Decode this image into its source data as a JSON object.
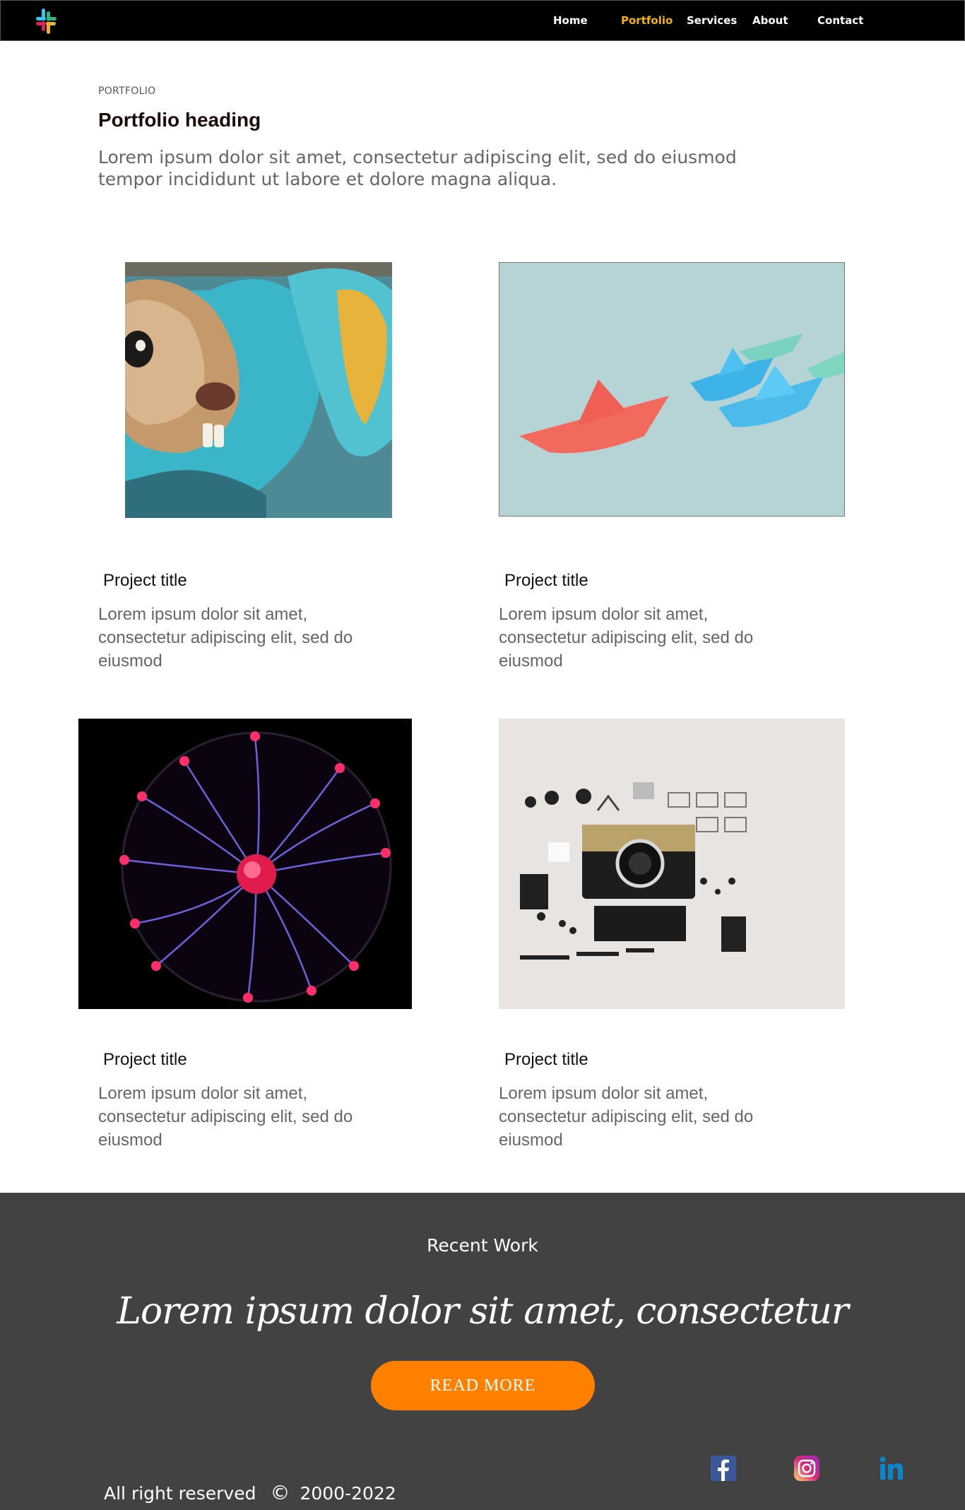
{
  "nav": {
    "logo_icon": "slack-logo-icon",
    "items": [
      {
        "label": "Home",
        "active": false
      },
      {
        "label": "Portfolio",
        "active": true
      },
      {
        "label": "Services",
        "active": false
      },
      {
        "label": "About",
        "active": false
      },
      {
        "label": "Contact",
        "active": false
      }
    ],
    "active_color": "#f5b400"
  },
  "header": {
    "eyebrow": "PORTFOLIO",
    "heading": "Portfolio heading",
    "lead": "Lorem ipsum dolor sit amet, consectetur adipiscing elit, sed do eiusmod tempor incididunt ut labore et dolore magna aliqua."
  },
  "projects": [
    {
      "image": "graffiti-beaver-image",
      "title": "Project title",
      "text": "Lorem ipsum dolor sit amet, consectetur adipiscing elit, sed do eiusmod"
    },
    {
      "image": "paper-boats-image",
      "title": "Project title",
      "text": "Lorem ipsum dolor sit amet, consectetur adipiscing elit, sed do eiusmod"
    },
    {
      "image": "plasma-ball-image",
      "title": "Project title",
      "text": "Lorem ipsum dolor sit amet, consectetur adipiscing elit, sed do eiusmod"
    },
    {
      "image": "disassembled-camera-image",
      "title": "Project title",
      "text": "Lorem ipsum dolor sit amet, consectetur adipiscing elit, sed do eiusmod"
    }
  ],
  "footer": {
    "background": "#434242",
    "recent": "Recent Work",
    "tagline": "Lorem ipsum dolor sit amet, consectetur",
    "button_label": "READ MORE",
    "button_color": "#ff7f00",
    "copyright_text": "All right reserved",
    "copyright_symbol": "©",
    "years": "2000-2022",
    "social": [
      "facebook-icon",
      "instagram-icon",
      "linkedin-icon"
    ]
  }
}
